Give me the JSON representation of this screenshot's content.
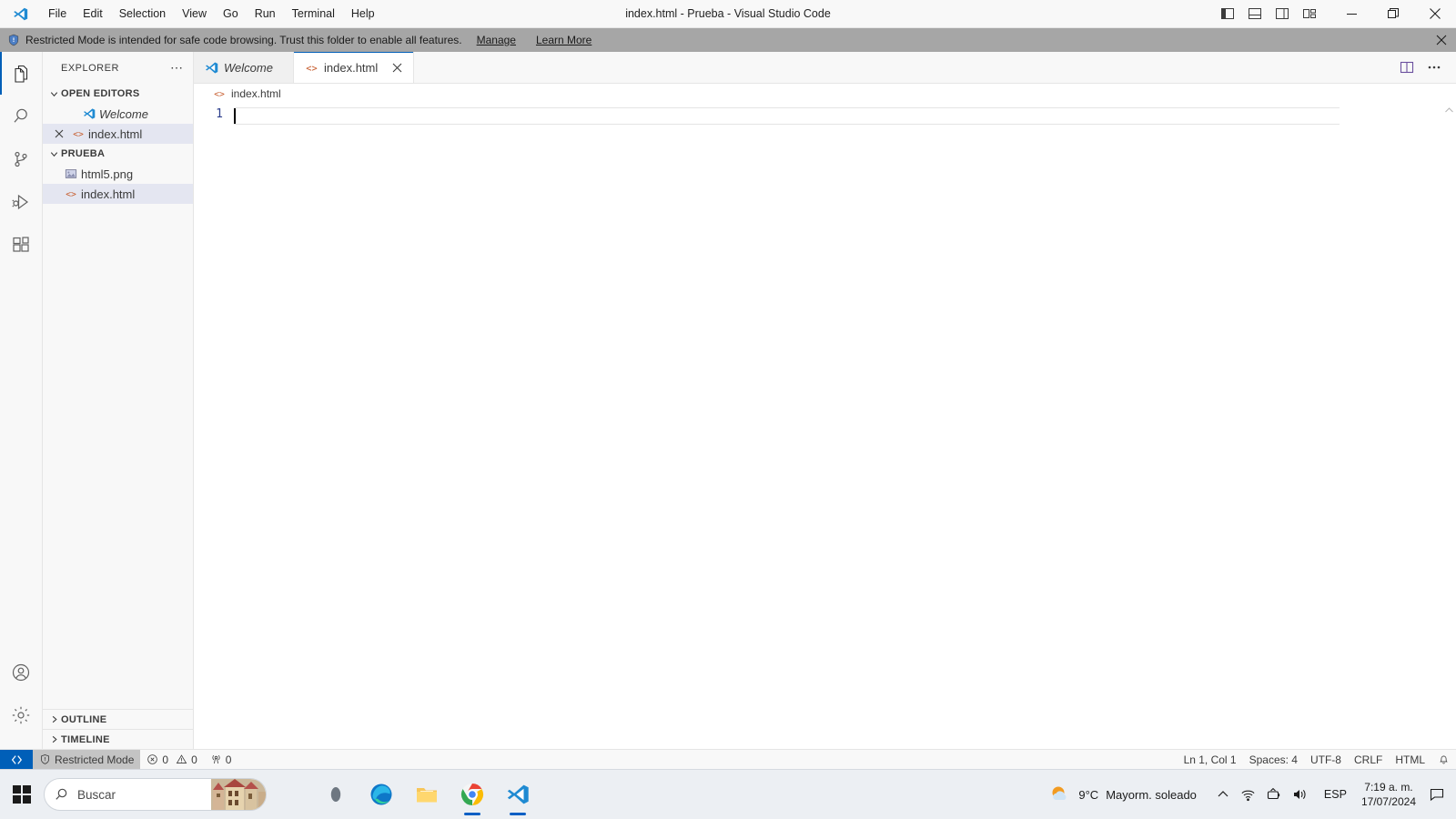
{
  "window": {
    "title": "index.html - Prueba - Visual Studio Code",
    "logo_icon": "vscode-logo-icon",
    "menus": [
      "File",
      "Edit",
      "Selection",
      "View",
      "Go",
      "Run",
      "Terminal",
      "Help"
    ],
    "layout_buttons": [
      {
        "name": "toggle-primary-sidebar-icon",
        "label": "Toggle Primary Side Bar"
      },
      {
        "name": "toggle-panel-icon",
        "label": "Toggle Panel"
      },
      {
        "name": "toggle-secondary-sidebar-icon",
        "label": "Toggle Secondary Side Bar"
      },
      {
        "name": "customize-layout-icon",
        "label": "Customize Layout"
      }
    ],
    "controls": [
      {
        "name": "minimize-button",
        "glyph": "—"
      },
      {
        "name": "maximize-button",
        "glyph": "❐"
      },
      {
        "name": "close-button",
        "glyph": "✕"
      }
    ]
  },
  "banner": {
    "icon": "shield-icon",
    "text": "Restricted Mode is intended for safe code browsing. Trust this folder to enable all features.",
    "links": [
      "Manage",
      "Learn More"
    ],
    "close_icon": "close-icon",
    "background": "#a6a6a6"
  },
  "activitybar": {
    "items": [
      {
        "name": "activity-explorer",
        "icon": "files-icon",
        "active": true
      },
      {
        "name": "activity-search",
        "icon": "search-icon",
        "active": false
      },
      {
        "name": "activity-source-control",
        "icon": "source-control-icon",
        "active": false
      },
      {
        "name": "activity-run-debug",
        "icon": "run-and-debug-icon",
        "active": false
      },
      {
        "name": "activity-extensions",
        "icon": "extensions-icon",
        "active": false
      }
    ],
    "bottom": [
      {
        "name": "activity-accounts",
        "icon": "account-icon"
      },
      {
        "name": "activity-settings",
        "icon": "gear-icon"
      }
    ]
  },
  "sidebar": {
    "title": "EXPLORER",
    "more_actions_icon": "ellipsis-icon",
    "sections": [
      {
        "name": "open-editors",
        "label": "OPEN EDITORS",
        "expanded": true,
        "items": [
          {
            "label": "Welcome",
            "icon": "vscode-logo-icon",
            "italic": true,
            "selected": false,
            "closable": false
          },
          {
            "label": "index.html",
            "icon": "html-icon",
            "italic": false,
            "selected": true,
            "closable": true
          }
        ]
      },
      {
        "name": "folder-prueba",
        "label": "PRUEBA",
        "expanded": true,
        "items": [
          {
            "label": "html5.png",
            "icon": "image-icon",
            "italic": false,
            "selected": false,
            "closable": false
          },
          {
            "label": "index.html",
            "icon": "html-icon",
            "italic": false,
            "selected": true,
            "closable": false
          }
        ]
      }
    ],
    "bottom_sections": [
      {
        "name": "outline-section",
        "label": "OUTLINE",
        "expanded": false
      },
      {
        "name": "timeline-section",
        "label": "TIMELINE",
        "expanded": false
      }
    ]
  },
  "editor": {
    "tabs": [
      {
        "name": "tab-welcome",
        "label": "Welcome",
        "icon": "vscode-logo-icon",
        "active": false,
        "italic": true,
        "closable": false
      },
      {
        "name": "tab-index-html",
        "label": "index.html",
        "icon": "html-icon",
        "active": true,
        "italic": false,
        "closable": true
      }
    ],
    "actions": [
      {
        "name": "split-editor-right-icon"
      },
      {
        "name": "more-actions-icon"
      }
    ],
    "breadcrumb": {
      "icon": "html-icon",
      "label": "index.html"
    },
    "content": {
      "line_numbers": [
        "1"
      ],
      "lines": [
        ""
      ]
    }
  },
  "statusbar": {
    "remote_icon": "remote-window-icon",
    "left": [
      {
        "name": "status-restricted-mode",
        "icon": "shield-icon",
        "label": "Restricted Mode",
        "highlight": true
      },
      {
        "name": "status-problems",
        "errors": "0",
        "warnings": "0",
        "error_icon": "error-icon",
        "warning_icon": "warning-icon"
      },
      {
        "name": "status-ports",
        "icon": "radio-tower-icon",
        "label": "0"
      }
    ],
    "right": [
      {
        "name": "status-cursor-position",
        "label": "Ln 1, Col 1"
      },
      {
        "name": "status-indentation",
        "label": "Spaces: 4"
      },
      {
        "name": "status-encoding",
        "label": "UTF-8"
      },
      {
        "name": "status-eol",
        "label": "CRLF"
      },
      {
        "name": "status-language-mode",
        "label": "HTML"
      },
      {
        "name": "status-notifications",
        "icon": "bell-icon",
        "label": ""
      }
    ]
  },
  "taskbar": {
    "start_icon": "windows-start-icon",
    "search": {
      "icon": "search-icon",
      "placeholder": "Buscar",
      "value": ""
    },
    "apps": [
      {
        "name": "taskbar-widgets",
        "icon": "widgets-icon",
        "running": false
      },
      {
        "name": "taskbar-edge",
        "icon": "microsoft-edge-icon",
        "running": false
      },
      {
        "name": "taskbar-file-explorer",
        "icon": "file-explorer-icon",
        "running": false
      },
      {
        "name": "taskbar-chrome",
        "icon": "google-chrome-icon",
        "running": true
      },
      {
        "name": "taskbar-vscode",
        "icon": "vscode-logo-icon",
        "running": true
      }
    ],
    "tray": {
      "weather": {
        "icon": "partly-sunny-icon",
        "temperature": "9°C",
        "condition": "Mayorm. soleado"
      },
      "chevron_icon": "chevron-up-icon",
      "icons": [
        {
          "name": "network-icon"
        },
        {
          "name": "battery-icon"
        },
        {
          "name": "volume-icon"
        }
      ],
      "language": "ESP",
      "time": "7:19 a. m.",
      "date": "17/07/2024",
      "notification_icon": "notification-center-icon"
    }
  },
  "colors": {
    "accent": "#005fb8",
    "html_orange": "#c65b2c",
    "banner_bg": "#a6a6a6",
    "selection": "#e4e6f1"
  }
}
